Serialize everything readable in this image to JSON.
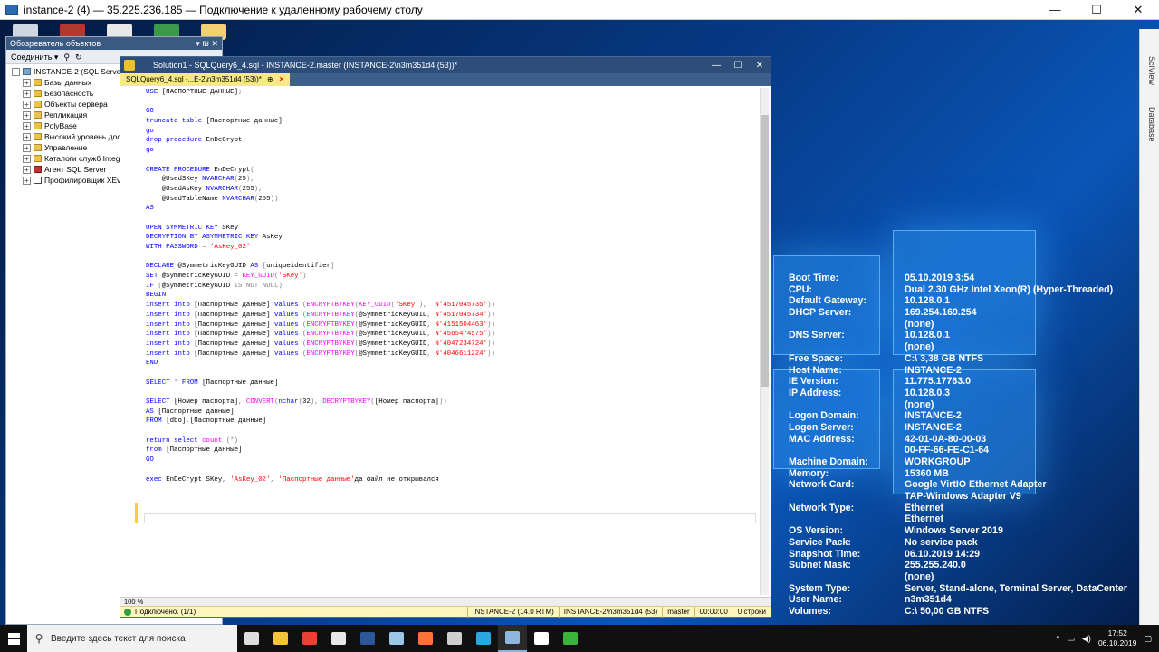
{
  "rdp": {
    "title": "instance-2 (4) — 35.225.236.185 — Подключение к удаленному рабочему столу",
    "minimize": "—",
    "maximize": "☐",
    "close": "✕"
  },
  "object_explorer": {
    "title": "Обозреватель объектов",
    "pin": "▾ ₪ ✕",
    "connect_label": "Соединить ▾",
    "items": [
      {
        "label": "INSTANCE-2 (SQL Server 14",
        "expand": "−",
        "icon": "server-icon"
      },
      {
        "label": "Базы данных",
        "expand": "+",
        "icon": "folder-icon"
      },
      {
        "label": "Безопасность",
        "expand": "+",
        "icon": "folder-icon"
      },
      {
        "label": "Объекты сервера",
        "expand": "+",
        "icon": "folder-icon"
      },
      {
        "label": "Репликация",
        "expand": "+",
        "icon": "folder-icon"
      },
      {
        "label": "PolyBase",
        "expand": "+",
        "icon": "folder-icon"
      },
      {
        "label": "Высокий уровень дост",
        "expand": "+",
        "icon": "folder-icon"
      },
      {
        "label": "Управление",
        "expand": "+",
        "icon": "folder-icon"
      },
      {
        "label": "Каталоги служб Integr",
        "expand": "+",
        "icon": "folder-icon"
      },
      {
        "label": "Агент SQL Server",
        "expand": "+",
        "icon": "agent-icon"
      },
      {
        "label": "Профилировщик XEve",
        "expand": "+",
        "icon": "profiler-icon"
      }
    ]
  },
  "ssms": {
    "window_title": "Solution1 - SQLQuery6_4.sql - INSTANCE-2.master (INSTANCE-2\\n3m351d4 (53))*",
    "tab_label": "SQLQuery6_4.sql -...E-2\\n3m351d4 (53))*",
    "tab_pin": "⊕",
    "tab_close": "✕",
    "zoom": "100 %",
    "status": {
      "message": "Подключено. (1/1)",
      "server": "INSTANCE-2 (14.0 RTM)",
      "user": "INSTANCE-2\\n3m351d4 (53)",
      "db": "master",
      "time": "00:00:00",
      "rows": "0 строки"
    }
  },
  "code_lines": [
    [
      [
        "kw",
        "USE "
      ],
      [
        "",
        "[ПАСПОРТНЫЕ ДАННЫЕ]"
      ],
      [
        "gr",
        ";"
      ]
    ],
    [],
    [
      [
        "kw",
        "GO"
      ]
    ],
    [
      [
        "kw",
        "truncate table "
      ],
      [
        "",
        "[Паспортные данные]"
      ]
    ],
    [
      [
        "kw",
        "go"
      ]
    ],
    [
      [
        "kw",
        "drop procedure "
      ],
      [
        "",
        "EnDeCrypt"
      ],
      [
        "gr",
        ";"
      ]
    ],
    [
      [
        "kw",
        "go"
      ]
    ],
    [],
    [
      [
        "kw",
        "CREATE PROCEDURE "
      ],
      [
        "",
        "EnDeCrypt"
      ],
      [
        "gr",
        "("
      ]
    ],
    [
      [
        "",
        "    @UsedSKey "
      ],
      [
        "kw",
        "NVARCHAR"
      ],
      [
        "gr",
        "("
      ],
      [
        "",
        "25"
      ],
      [
        "gr",
        "),"
      ]
    ],
    [
      [
        "",
        "    @UsedAsKey "
      ],
      [
        "kw",
        "NVARCHAR"
      ],
      [
        "gr",
        "("
      ],
      [
        "",
        "255"
      ],
      [
        "gr",
        "),"
      ]
    ],
    [
      [
        "",
        "    @UsedTableName "
      ],
      [
        "kw",
        "NVARCHAR"
      ],
      [
        "gr",
        "("
      ],
      [
        "",
        "255"
      ],
      [
        "gr",
        "))"
      ]
    ],
    [
      [
        "kw",
        "AS"
      ]
    ],
    [],
    [
      [
        "kw",
        "OPEN SYMMETRIC KEY "
      ],
      [
        "",
        "SKey"
      ]
    ],
    [
      [
        "kw",
        "DECRYPTION BY ASYMMETRIC KEY "
      ],
      [
        "",
        "AsKey"
      ]
    ],
    [
      [
        "kw",
        "WITH PASSWORD "
      ],
      [
        "gr",
        "= "
      ],
      [
        "str",
        "'AsKey_02'"
      ]
    ],
    [],
    [
      [
        "kw",
        "DECLARE "
      ],
      [
        "",
        "@SymmetricKeyGUID "
      ],
      [
        "kw",
        "AS "
      ],
      [
        "gr",
        "["
      ],
      [
        "",
        "uniqueidentifier"
      ],
      [
        "gr",
        "]"
      ]
    ],
    [
      [
        "kw",
        "SET "
      ],
      [
        "",
        "@SymmetricKeyGUID "
      ],
      [
        "gr",
        "= "
      ],
      [
        "fn",
        "KEY_GUID"
      ],
      [
        "gr",
        "("
      ],
      [
        "str",
        "'SKey'"
      ],
      [
        "gr",
        ")"
      ]
    ],
    [
      [
        "kw",
        "IF "
      ],
      [
        "gr",
        "("
      ],
      [
        "",
        "@SymmetricKeyGUID "
      ],
      [
        "gr",
        "IS NOT NULL)"
      ]
    ],
    [
      [
        "kw",
        "BEGIN"
      ]
    ],
    [
      [
        "kw",
        "insert into "
      ],
      [
        "",
        "[Паспортные данные] "
      ],
      [
        "kw",
        "values "
      ],
      [
        "gr",
        "("
      ],
      [
        "fn",
        "ENCRYPTBYKEY"
      ],
      [
        "gr",
        "("
      ],
      [
        "fn",
        "KEY_GUID"
      ],
      [
        "gr",
        "("
      ],
      [
        "str",
        "'SKey'"
      ],
      [
        "gr",
        "),  "
      ],
      [
        "str",
        "N'4517045735'"
      ],
      [
        "gr",
        "))"
      ]
    ],
    [
      [
        "kw",
        "insert into "
      ],
      [
        "",
        "[Паспортные данные] "
      ],
      [
        "kw",
        "values "
      ],
      [
        "gr",
        "("
      ],
      [
        "fn",
        "ENCRYPTBYKEY"
      ],
      [
        "gr",
        "("
      ],
      [
        "",
        "@SymmetricKeyGUID"
      ],
      [
        "gr",
        ", "
      ],
      [
        "str",
        "N'4517045734'"
      ],
      [
        "gr",
        "))"
      ]
    ],
    [
      [
        "kw",
        "insert into "
      ],
      [
        "",
        "[Паспортные данные] "
      ],
      [
        "kw",
        "values "
      ],
      [
        "gr",
        "("
      ],
      [
        "fn",
        "ENCRYPTBYKEY"
      ],
      [
        "gr",
        "("
      ],
      [
        "",
        "@SymmetricKeyGUID"
      ],
      [
        "gr",
        ", "
      ],
      [
        "str",
        "N'4151504463'"
      ],
      [
        "gr",
        "))"
      ]
    ],
    [
      [
        "kw",
        "insert into "
      ],
      [
        "",
        "[Паспортные данные] "
      ],
      [
        "kw",
        "values "
      ],
      [
        "gr",
        "("
      ],
      [
        "fn",
        "ENCRYPTBYKEY"
      ],
      [
        "gr",
        "("
      ],
      [
        "",
        "@SymmetricKeyGUID"
      ],
      [
        "gr",
        ", "
      ],
      [
        "str",
        "N'4565474575'"
      ],
      [
        "gr",
        "))"
      ]
    ],
    [
      [
        "kw",
        "insert into "
      ],
      [
        "",
        "[Паспортные данные] "
      ],
      [
        "kw",
        "values "
      ],
      [
        "gr",
        "("
      ],
      [
        "fn",
        "ENCRYPTBYKEY"
      ],
      [
        "gr",
        "("
      ],
      [
        "",
        "@SymmetricKeyGUID"
      ],
      [
        "gr",
        ", "
      ],
      [
        "str",
        "N'4047234724'"
      ],
      [
        "gr",
        "))"
      ]
    ],
    [
      [
        "kw",
        "insert into "
      ],
      [
        "",
        "[Паспортные данные] "
      ],
      [
        "kw",
        "values "
      ],
      [
        "gr",
        "("
      ],
      [
        "fn",
        "ENCRYPTBYKEY"
      ],
      [
        "gr",
        "("
      ],
      [
        "",
        "@SymmetricKeyGUID"
      ],
      [
        "gr",
        ", "
      ],
      [
        "str",
        "N'4046611224'"
      ],
      [
        "gr",
        "))"
      ]
    ],
    [
      [
        "kw",
        "END"
      ]
    ],
    [],
    [
      [
        "kw",
        "SELECT "
      ],
      [
        "gr",
        "* "
      ],
      [
        "kw",
        "FROM "
      ],
      [
        "",
        "[Паспортные данные]"
      ]
    ],
    [],
    [
      [
        "kw",
        "SELECT "
      ],
      [
        "",
        "[Номер паспорта]"
      ],
      [
        "gr",
        ", "
      ],
      [
        "fn",
        "CONVERT"
      ],
      [
        "gr",
        "("
      ],
      [
        "kw",
        "nchar"
      ],
      [
        "gr",
        "("
      ],
      [
        "",
        "32"
      ],
      [
        "gr",
        "), "
      ],
      [
        "fn",
        "DECRYPTBYKEY"
      ],
      [
        "gr",
        "("
      ],
      [
        "",
        "[Номер паспорта]"
      ],
      [
        "gr",
        "))"
      ]
    ],
    [
      [
        "kw",
        "AS "
      ],
      [
        "",
        "[Паспортные данные]"
      ]
    ],
    [
      [
        "kw",
        "FROM "
      ],
      [
        "",
        "[dbo]"
      ],
      [
        "gr",
        "."
      ],
      [
        "",
        "[Паспортные данные]"
      ]
    ],
    [],
    [
      [
        "kw",
        "return select "
      ],
      [
        "fn",
        "count "
      ],
      [
        "gr",
        "(*)"
      ]
    ],
    [
      [
        "kw",
        "from "
      ],
      [
        "",
        "[Паспортные данные]"
      ]
    ],
    [
      [
        "kw",
        "GO"
      ]
    ],
    [],
    [
      [
        "",
        ""
      ],
      [
        "kw",
        "exec "
      ],
      [
        "",
        "EnDeCrypt SKey"
      ],
      [
        "gr",
        ", "
      ],
      [
        "str",
        "'AsKey_02'"
      ],
      [
        "gr",
        ", "
      ],
      [
        "str",
        "'Паспортные данные'"
      ],
      [
        "",
        "да файл не открывался"
      ]
    ],
    []
  ],
  "bginfo": [
    {
      "label": "Boot Time:",
      "value": "05.10.2019 3:54"
    },
    {
      "label": "CPU:",
      "value": "Dual 2.30 GHz Intel Xeon(R) (Hyper-Threaded)"
    },
    {
      "label": "Default Gateway:",
      "value": "10.128.0.1"
    },
    {
      "label": "DHCP Server:",
      "value": "169.254.169.254"
    },
    {
      "label": "",
      "value": "(none)"
    },
    {
      "label": "DNS Server:",
      "value": "10.128.0.1"
    },
    {
      "label": "",
      "value": "(none)"
    },
    {
      "label": "Free Space:",
      "value": "C:\\ 3,38 GB NTFS"
    },
    {
      "label": "Host Name:",
      "value": "INSTANCE-2"
    },
    {
      "label": "IE Version:",
      "value": "11.775.17763.0"
    },
    {
      "label": "IP Address:",
      "value": "10.128.0.3"
    },
    {
      "label": "",
      "value": "(none)"
    },
    {
      "label": "Logon Domain:",
      "value": "INSTANCE-2"
    },
    {
      "label": "Logon Server:",
      "value": "INSTANCE-2"
    },
    {
      "label": "MAC Address:",
      "value": "42-01-0A-80-00-03"
    },
    {
      "label": "",
      "value": "00-FF-66-FE-C1-64"
    },
    {
      "label": "Machine Domain:",
      "value": "WORKGROUP"
    },
    {
      "label": "Memory:",
      "value": "15360 MB"
    },
    {
      "label": "Network Card:",
      "value": "Google VirtIO Ethernet Adapter"
    },
    {
      "label": "",
      "value": "TAP-Windows Adapter V9"
    },
    {
      "label": "Network Type:",
      "value": "Ethernet"
    },
    {
      "label": "",
      "value": "Ethernet"
    },
    {
      "label": "OS Version:",
      "value": "Windows Server 2019"
    },
    {
      "label": "Service Pack:",
      "value": "No service pack"
    },
    {
      "label": "Snapshot Time:",
      "value": "06.10.2019 14:29"
    },
    {
      "label": "Subnet Mask:",
      "value": "255.255.240.0"
    },
    {
      "label": "",
      "value": "(none)"
    },
    {
      "label": "System Type:",
      "value": "Server, Stand-alone, Terminal Server, DataCenter"
    },
    {
      "label": "User Name:",
      "value": "n3m351d4"
    },
    {
      "label": "Volumes:",
      "value": "C:\\ 50,00 GB NTFS"
    }
  ],
  "side_tabs": [
    "SciView",
    "Database"
  ],
  "taskbar": {
    "search_placeholder": "Введите здесь текст для поиска",
    "icons": [
      {
        "name": "task-view-icon",
        "color": "#dddddd"
      },
      {
        "name": "file-explorer-icon",
        "color": "#f3c33b"
      },
      {
        "name": "chrome-icon",
        "color": "#e94235"
      },
      {
        "name": "box-icon",
        "color": "#e8e8e8"
      },
      {
        "name": "word-icon",
        "color": "#2b579a"
      },
      {
        "name": "notepad-icon",
        "color": "#9ac7e8"
      },
      {
        "name": "firefox-icon",
        "color": "#ff7139"
      },
      {
        "name": "tool-icon",
        "color": "#cfcfcf"
      },
      {
        "name": "disk-icon",
        "color": "#2aa7de"
      },
      {
        "name": "ssms-icon",
        "color": "#8fb7e0"
      },
      {
        "name": "7zip-icon",
        "color": "#ffffff"
      },
      {
        "name": "terminal-icon",
        "color": "#3bb33b"
      }
    ],
    "clock_time": "17:52",
    "clock_date": "06.10.2019"
  }
}
